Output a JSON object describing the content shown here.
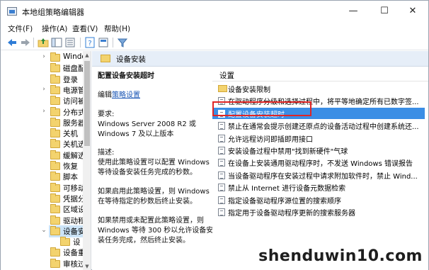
{
  "window": {
    "title": "本地组策略编辑器",
    "minimize": "—",
    "maximize": "☐",
    "close": "✕"
  },
  "menubar": [
    "文件(F)",
    "操作(A)",
    "查看(V)",
    "帮助(H)"
  ],
  "tree": {
    "items": [
      {
        "label": "Windo",
        "chev": "›"
      },
      {
        "label": "磁盘配",
        "chev": ""
      },
      {
        "label": "登录",
        "chev": ""
      },
      {
        "label": "电源管",
        "chev": "›"
      },
      {
        "label": "访问被",
        "chev": ""
      },
      {
        "label": "分布式",
        "chev": "›"
      },
      {
        "label": "服务器",
        "chev": ""
      },
      {
        "label": "关机",
        "chev": ""
      },
      {
        "label": "关机选",
        "chev": ""
      },
      {
        "label": "缓解选",
        "chev": ""
      },
      {
        "label": "恢复",
        "chev": ""
      },
      {
        "label": "脚本",
        "chev": ""
      },
      {
        "label": "可移动",
        "chev": ""
      },
      {
        "label": "凭据分",
        "chev": ""
      },
      {
        "label": "区域设",
        "chev": ""
      },
      {
        "label": "驱动程",
        "chev": ""
      },
      {
        "label": "设备安",
        "chev": "⌄",
        "selected": true
      },
      {
        "label": "设",
        "chev": "",
        "indent": true
      },
      {
        "label": "设备重",
        "chev": ""
      },
      {
        "label": "审核过",
        "chev": ""
      }
    ]
  },
  "content": {
    "header_title": "设备安装",
    "detail": {
      "title": "配置设备安装超时",
      "edit_prefix": "编辑",
      "edit_link": "策略设置",
      "requirements_label": "要求:",
      "req_line1": "Windows Server 2008 R2 或",
      "req_line2": "Windows 7 及以上版本",
      "desc_label": "描述:",
      "desc_line1": "使用此策略设置可以配置 Windows",
      "desc_line2": "等待设备安装任务完成的秒数。",
      "enabled_line1": "如果启用此策略设置，则 Windows",
      "enabled_line2": "在等待指定的秒数后终止安装。",
      "disabled_line1": "如果禁用或未配置此策略设置，则",
      "disabled_line2": "Windows 等待 300 秒以允许设备安",
      "disabled_line3": "装任务完成，然后终止安装。"
    },
    "list_header": "设置",
    "rows": [
      {
        "text": "设备安装限制",
        "type": "folder"
      },
      {
        "text": "在驱动程序分级和选择过程中，将平等地确定所有已数字签...",
        "type": "policy"
      },
      {
        "text": "配置设备安装超时",
        "type": "policy",
        "selected": true
      },
      {
        "text": "禁止在通常会提示创建还原点的设备活动过程中创建系统还...",
        "type": "policy"
      },
      {
        "text": "允许远程访问即插即用接口",
        "type": "policy"
      },
      {
        "text": "安装设备过程中禁用\"找到新硬件\"气球",
        "type": "policy"
      },
      {
        "text": "在设备上安装通用驱动程序时，不发送 Windows 错误报告",
        "type": "policy"
      },
      {
        "text": "当设备驱动程序在安装过程中请求附加软件时，禁止 Wind...",
        "type": "policy"
      },
      {
        "text": "禁止从 Internet 进行设备元数据检索",
        "type": "policy"
      },
      {
        "text": "指定设备驱动程序源位置的搜索顺序",
        "type": "policy"
      },
      {
        "text": "指定用于设备驱动程序更新的搜索服务器",
        "type": "policy"
      }
    ]
  },
  "watermark": "shenduwin10.com",
  "colors": {
    "accent": "#3b8ee5",
    "highlight_border": "#e02525",
    "header_bg": "#e6eef8"
  }
}
